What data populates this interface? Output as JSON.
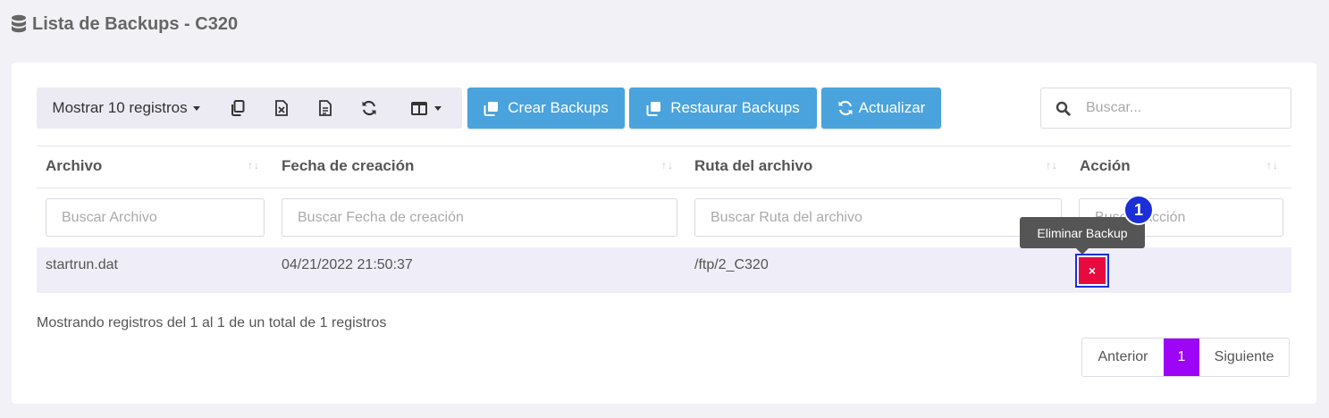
{
  "header": {
    "title": "Lista de Backups - C320",
    "icon": "database-icon"
  },
  "toolbar": {
    "length_label": "Mostrar 10 registros",
    "buttons": [
      {
        "label": "Crear Backups",
        "icon": "copy-icon"
      },
      {
        "label": "Restaurar Backups",
        "icon": "copy-icon"
      },
      {
        "label": "Actualizar",
        "icon": "refresh-icon"
      }
    ]
  },
  "search": {
    "placeholder": "Buscar..."
  },
  "table": {
    "columns": [
      "Archivo",
      "Fecha de creación",
      "Ruta del archivo",
      "Acción"
    ],
    "filters": [
      "Buscar Archivo",
      "Buscar Fecha de creación",
      "Buscar Ruta del archivo",
      "Buscar Acción"
    ],
    "rows": [
      {
        "archivo": "startrun.dat",
        "fecha": "04/21/2022 21:50:37",
        "ruta": "/ftp/2_C320",
        "accion_label": "×"
      }
    ]
  },
  "tooltip": {
    "text": "Eliminar Backup"
  },
  "badge": {
    "number": "1"
  },
  "info": {
    "text": "Mostrando registros del 1 al 1 de un total de 1 registros"
  },
  "pagination": {
    "prev": "Anterior",
    "current": "1",
    "next": "Siguiente"
  },
  "colors": {
    "primary": "#4aa3dc",
    "danger": "#e8093f",
    "page_active": "#9c05f5",
    "annotation": "#1a2fd6"
  }
}
